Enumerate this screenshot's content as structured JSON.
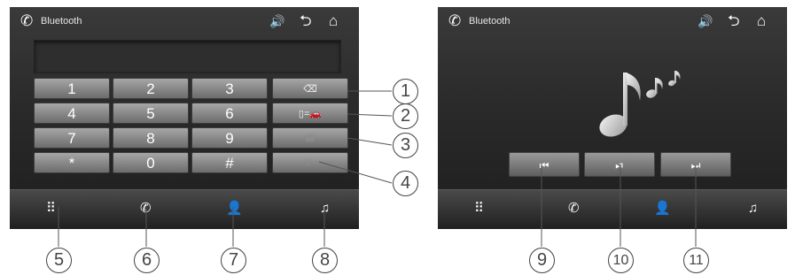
{
  "screen1": {
    "title": "Bluetooth",
    "header_icons": [
      "phone-icon",
      "volume-icon",
      "back-icon",
      "home-icon"
    ],
    "display_text": "",
    "keypad": [
      "1",
      "2",
      "3",
      "4",
      "5",
      "6",
      "7",
      "8",
      "9",
      "*",
      "0",
      "#"
    ],
    "function_keys": [
      {
        "name": "backspace-button",
        "glyph": "⌫"
      },
      {
        "name": "transfer-button",
        "glyph": "▯=🚗"
      },
      {
        "name": "hangup-button",
        "glyph": "☎"
      },
      {
        "name": "call-button",
        "glyph": "☾"
      }
    ],
    "bottom_bar": [
      "dialpad-icon",
      "call-log-icon",
      "contacts-icon",
      "music-icon"
    ]
  },
  "screen2": {
    "title": "Bluetooth",
    "header_icons": [
      "phone-icon",
      "volume-icon",
      "back-icon",
      "home-icon"
    ],
    "controls": [
      {
        "name": "previous-track-button",
        "glyph": "⏮"
      },
      {
        "name": "play-pause-button",
        "glyph": "⏯"
      },
      {
        "name": "next-track-button",
        "glyph": "⏭"
      }
    ],
    "bottom_bar": [
      "dialpad-icon",
      "call-log-icon",
      "contacts-icon",
      "music-icon"
    ]
  },
  "callouts": [
    "1",
    "2",
    "3",
    "4",
    "5",
    "6",
    "7",
    "8",
    "9",
    "10",
    "11"
  ],
  "colors": {
    "screen_dark": "#2a2a2a",
    "key": "#8a8a8a",
    "callout": "#444444"
  }
}
